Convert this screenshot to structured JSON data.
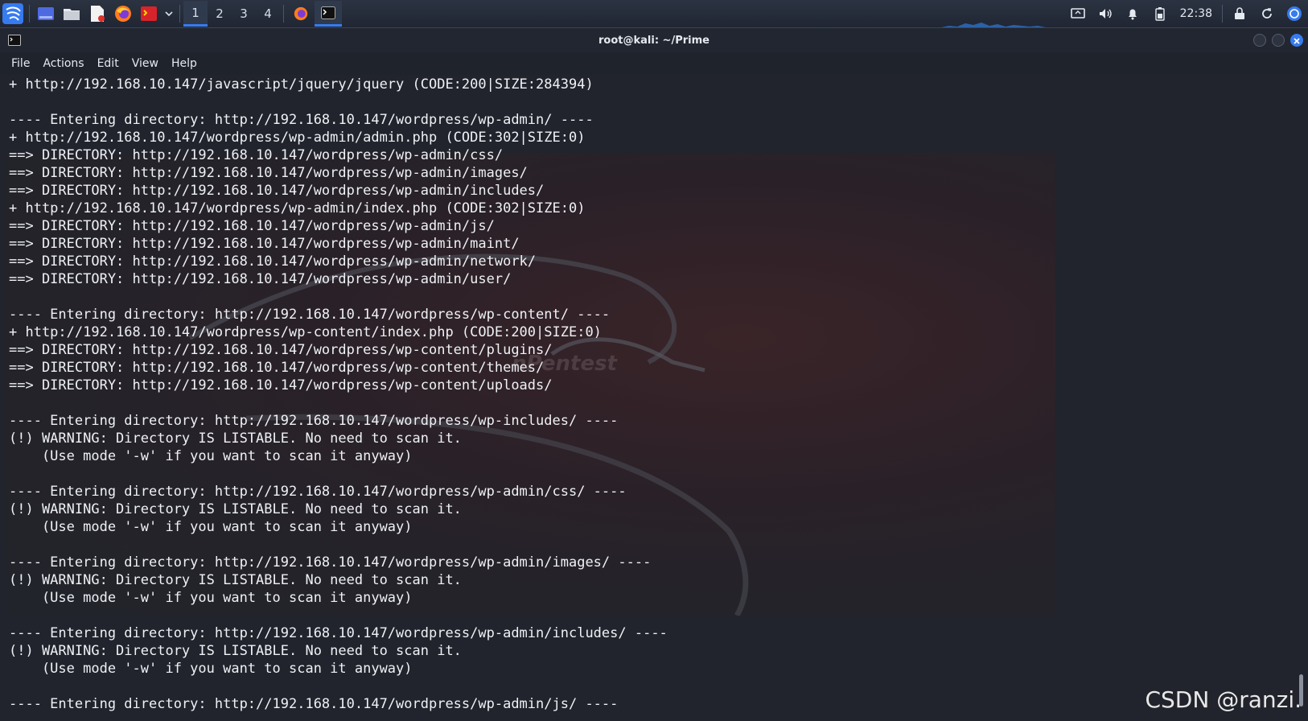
{
  "taskbar": {
    "workspaces": [
      "1",
      "2",
      "3",
      "4"
    ],
    "active_workspace": "1",
    "clock": "22:38"
  },
  "window": {
    "title": "root@kali: ~/Prime"
  },
  "menu": [
    "File",
    "Actions",
    "Edit",
    "View",
    "Help"
  ],
  "terminal": {
    "lines": [
      "+ http://192.168.10.147/javascript/jquery/jquery (CODE:200|SIZE:284394)",
      "",
      "---- Entering directory: http://192.168.10.147/wordpress/wp-admin/ ----",
      "+ http://192.168.10.147/wordpress/wp-admin/admin.php (CODE:302|SIZE:0)",
      "==> DIRECTORY: http://192.168.10.147/wordpress/wp-admin/css/",
      "==> DIRECTORY: http://192.168.10.147/wordpress/wp-admin/images/",
      "==> DIRECTORY: http://192.168.10.147/wordpress/wp-admin/includes/",
      "+ http://192.168.10.147/wordpress/wp-admin/index.php (CODE:302|SIZE:0)",
      "==> DIRECTORY: http://192.168.10.147/wordpress/wp-admin/js/",
      "==> DIRECTORY: http://192.168.10.147/wordpress/wp-admin/maint/",
      "==> DIRECTORY: http://192.168.10.147/wordpress/wp-admin/network/",
      "==> DIRECTORY: http://192.168.10.147/wordpress/wp-admin/user/",
      "",
      "---- Entering directory: http://192.168.10.147/wordpress/wp-content/ ----",
      "+ http://192.168.10.147/wordpress/wp-content/index.php (CODE:200|SIZE:0)",
      "==> DIRECTORY: http://192.168.10.147/wordpress/wp-content/plugins/",
      "==> DIRECTORY: http://192.168.10.147/wordpress/wp-content/themes/",
      "==> DIRECTORY: http://192.168.10.147/wordpress/wp-content/uploads/",
      "",
      "---- Entering directory: http://192.168.10.147/wordpress/wp-includes/ ----",
      "(!) WARNING: Directory IS LISTABLE. No need to scan it.",
      "    (Use mode '-w' if you want to scan it anyway)",
      "",
      "---- Entering directory: http://192.168.10.147/wordpress/wp-admin/css/ ----",
      "(!) WARNING: Directory IS LISTABLE. No need to scan it.",
      "    (Use mode '-w' if you want to scan it anyway)",
      "",
      "---- Entering directory: http://192.168.10.147/wordpress/wp-admin/images/ ----",
      "(!) WARNING: Directory IS LISTABLE. No need to scan it.",
      "    (Use mode '-w' if you want to scan it anyway)",
      "",
      "---- Entering directory: http://192.168.10.147/wordpress/wp-admin/includes/ ----",
      "(!) WARNING: Directory IS LISTABLE. No need to scan it.",
      "    (Use mode '-w' if you want to scan it anyway)",
      "",
      "---- Entering directory: http://192.168.10.147/wordpress/wp-admin/js/ ----"
    ]
  },
  "wallpaper": {
    "text": "nPentest"
  },
  "watermark": "CSDN @ranzi.",
  "colors": {
    "accent": "#367bf0",
    "terminal_bg": "#21242c",
    "text": "#eef1f5"
  }
}
